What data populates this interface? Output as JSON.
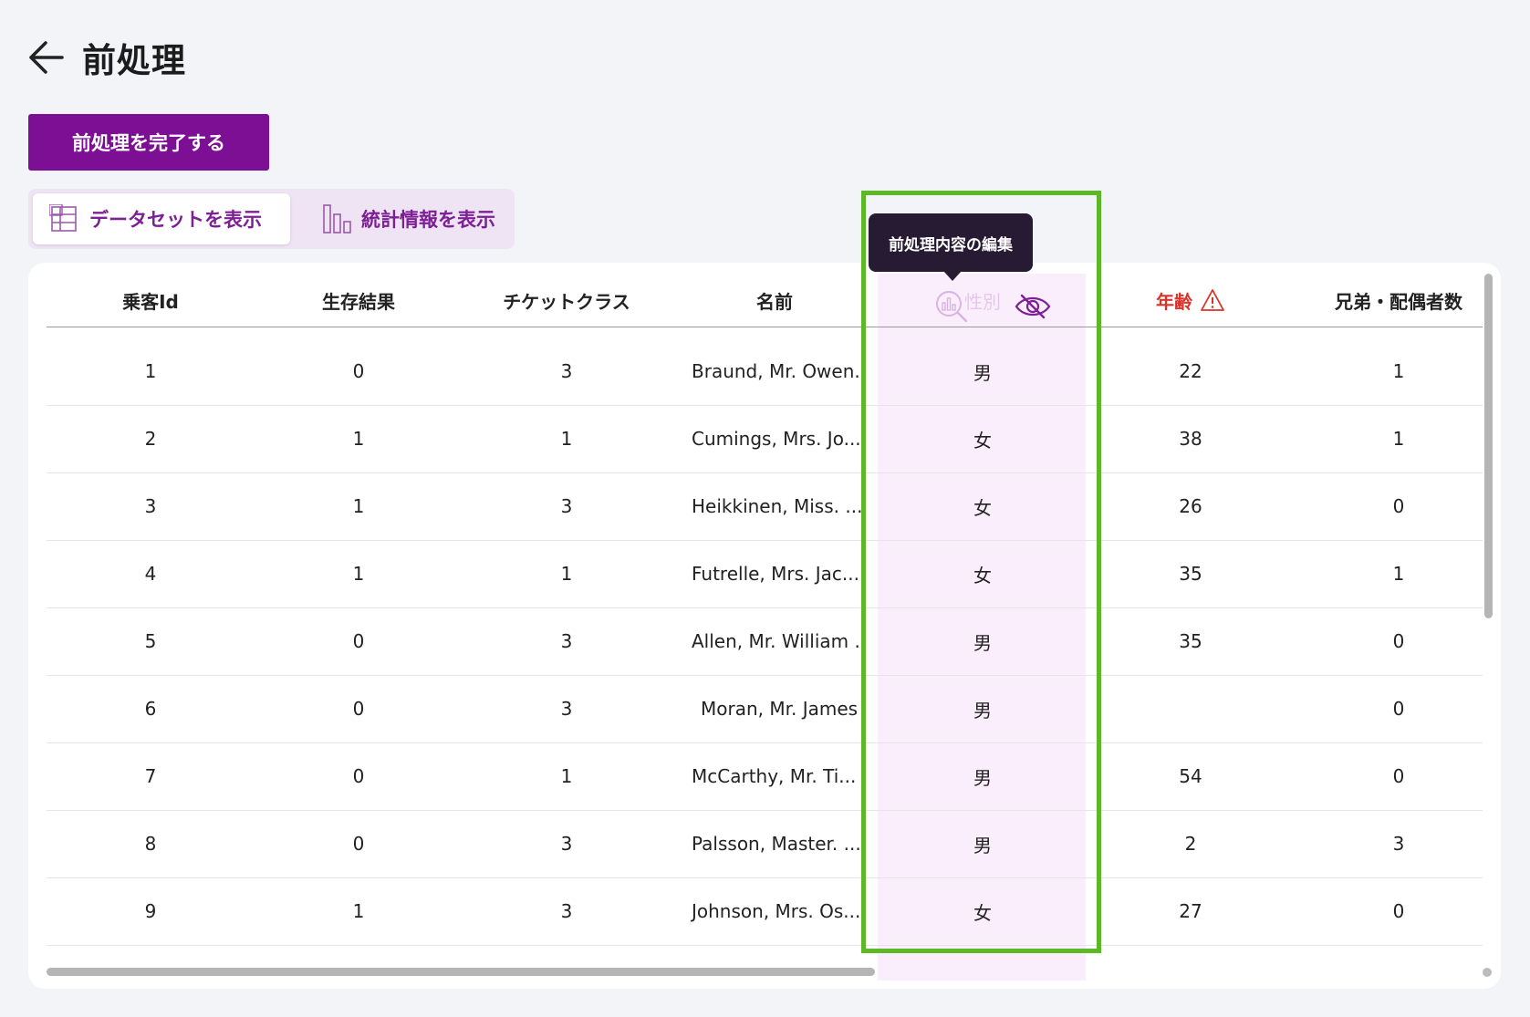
{
  "header": {
    "title": "前処理"
  },
  "actions": {
    "complete_label": "前処理を完了する"
  },
  "view_toggle": {
    "dataset_label": "データセットを表示",
    "stats_label": "統計情報を表示",
    "active": "dataset"
  },
  "tooltip": {
    "text": "前処理内容の編集"
  },
  "table": {
    "columns": [
      "乗客Id",
      "生存結果",
      "チケットクラス",
      "名前",
      "性別",
      "年齢",
      "兄弟・配偶者数"
    ],
    "warning_column": "年齢",
    "selected_column": "性別",
    "rows": [
      [
        "1",
        "0",
        "3",
        "Braund, Mr. Owen...",
        "男",
        "22",
        "1"
      ],
      [
        "2",
        "1",
        "1",
        "Cumings, Mrs. Jo...",
        "女",
        "38",
        "1"
      ],
      [
        "3",
        "1",
        "3",
        "Heikkinen, Miss. ...",
        "女",
        "26",
        "0"
      ],
      [
        "4",
        "1",
        "1",
        "Futrelle, Mrs. Jac...",
        "女",
        "35",
        "1"
      ],
      [
        "5",
        "0",
        "3",
        "Allen, Mr. William ...",
        "男",
        "35",
        "0"
      ],
      [
        "6",
        "0",
        "3",
        "Moran, Mr. James",
        "男",
        "",
        "0"
      ],
      [
        "7",
        "0",
        "1",
        "McCarthy, Mr. Ti...",
        "男",
        "54",
        "0"
      ],
      [
        "8",
        "0",
        "3",
        "Palsson, Master. ...",
        "男",
        "2",
        "3"
      ],
      [
        "9",
        "1",
        "3",
        "Johnson, Mrs. Os...",
        "女",
        "27",
        "0"
      ]
    ]
  },
  "colors": {
    "primary": "#7d0f95",
    "selected_column_bg": "#fbeefc",
    "highlight": "#5cb827",
    "warning": "#d9342b",
    "tooltip_bg": "#271a33"
  },
  "icons": {
    "back": "arrow-left-icon",
    "dataset": "table-icon",
    "stats": "bar-chart-icon",
    "column_stats": "chart-search-icon",
    "hide_column": "eye-off-icon",
    "age_warning": "warning-icon"
  }
}
